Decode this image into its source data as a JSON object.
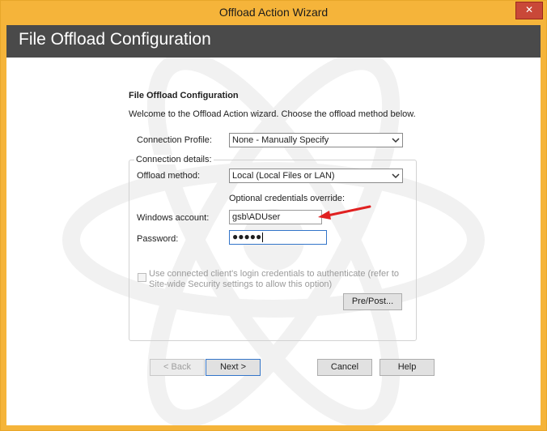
{
  "window": {
    "title": "Offload Action Wizard",
    "close_glyph": "✕"
  },
  "header": {
    "title": "File Offload Configuration"
  },
  "section": {
    "heading": "File Offload Configuration",
    "intro": "Welcome to the Offload Action wizard. Choose the offload method below."
  },
  "connection_profile": {
    "label": "Connection Profile:",
    "value": "None - Manually Specify"
  },
  "connection_details": {
    "legend": "Connection details:",
    "offload_method": {
      "label": "Offload method:",
      "value": "Local (Local Files or LAN)"
    },
    "credentials_caption": "Optional credentials override:",
    "windows_account": {
      "label": "Windows account:",
      "value": "gsb\\ADUser"
    },
    "password": {
      "label": "Password:",
      "masked": "●●●●●"
    },
    "use_client_credentials": {
      "line1": "Use connected client's login credentials to authenticate (refer to",
      "line2": "Site-wide Security settings to allow this option)",
      "checked": false,
      "enabled": false
    },
    "prepost_label": "Pre/Post..."
  },
  "footer": {
    "back_label": "< Back",
    "next_label": "Next >",
    "cancel_label": "Cancel",
    "help_label": "Help"
  },
  "colors": {
    "titlebar": "#f5b43a",
    "header_band": "#4a4a4a",
    "close_button": "#c94838",
    "annotation_arrow": "#e02020",
    "focus_border": "#3375c9"
  },
  "icons": {
    "close": "close-icon",
    "dropdown": "chevron-down-icon",
    "annotation": "red-arrow-annotation"
  }
}
